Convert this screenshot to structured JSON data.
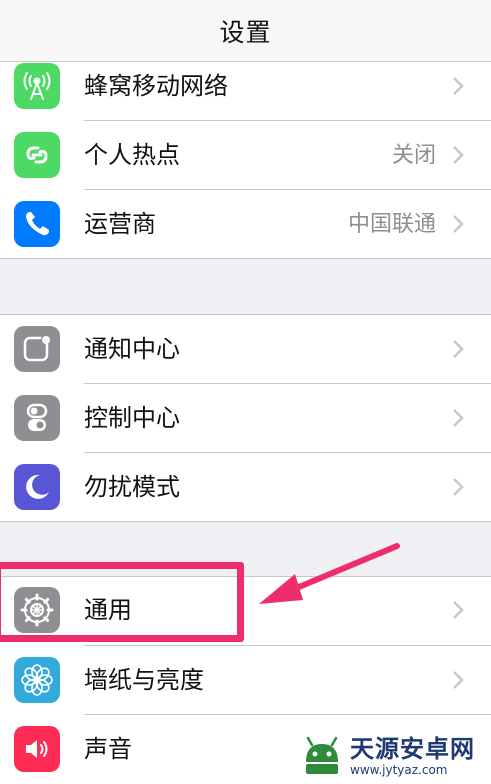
{
  "navbar": {
    "title": "设置"
  },
  "groups": [
    {
      "items": [
        {
          "label": "蜂窝移动网络",
          "detail": "",
          "icon": "antenna-icon",
          "color": "#4cd964"
        },
        {
          "label": "个人热点",
          "detail": "关闭",
          "icon": "hotspot-link-icon",
          "color": "#4cd964"
        },
        {
          "label": "运营商",
          "detail": "中国联通",
          "icon": "phone-icon",
          "color": "#007aff"
        }
      ]
    },
    {
      "items": [
        {
          "label": "通知中心",
          "detail": "",
          "icon": "notification-center-icon",
          "color": "#8e8e93"
        },
        {
          "label": "控制中心",
          "detail": "",
          "icon": "control-center-icon",
          "color": "#8e8e93"
        },
        {
          "label": "勿扰模式",
          "detail": "",
          "icon": "moon-icon",
          "color": "#5856d6"
        }
      ]
    },
    {
      "items": [
        {
          "label": "通用",
          "detail": "",
          "icon": "gear-icon",
          "color": "#8e8e93"
        },
        {
          "label": "墙纸与亮度",
          "detail": "",
          "icon": "flower-icon",
          "color": "#34aadc"
        },
        {
          "label": "声音",
          "detail": "",
          "icon": "speaker-icon",
          "color": "#ff2d55"
        }
      ]
    }
  ],
  "annotation": {
    "highlight_color": "#ee2e6b",
    "highlighted_item": "通用"
  },
  "watermark": {
    "name": "天源安卓网",
    "url": "www.jytyaz.com"
  }
}
